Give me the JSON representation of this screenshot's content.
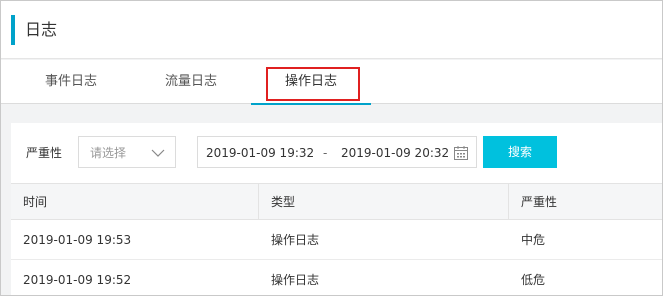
{
  "header": {
    "title": "日志"
  },
  "tabs": [
    {
      "label": "事件日志"
    },
    {
      "label": "流量日志"
    },
    {
      "label": "操作日志",
      "active": true
    }
  ],
  "filter": {
    "severity_label": "严重性",
    "severity_placeholder": "请选择",
    "start_time": "2019-01-09 19:32",
    "separator": "-",
    "end_time": "2019-01-09 20:32",
    "search_label": "搜索"
  },
  "table": {
    "columns": [
      "时间",
      "类型",
      "严重性"
    ],
    "rows": [
      [
        "2019-01-09 19:53",
        "操作日志",
        "中危"
      ],
      [
        "2019-01-09 19:52",
        "操作日志",
        "低危"
      ]
    ]
  },
  "colors": {
    "accent": "#00a2ca",
    "search_button": "#00c1de",
    "highlight": "#e02020"
  },
  "icons": [
    "chevron-down-icon",
    "calendar-icon"
  ]
}
